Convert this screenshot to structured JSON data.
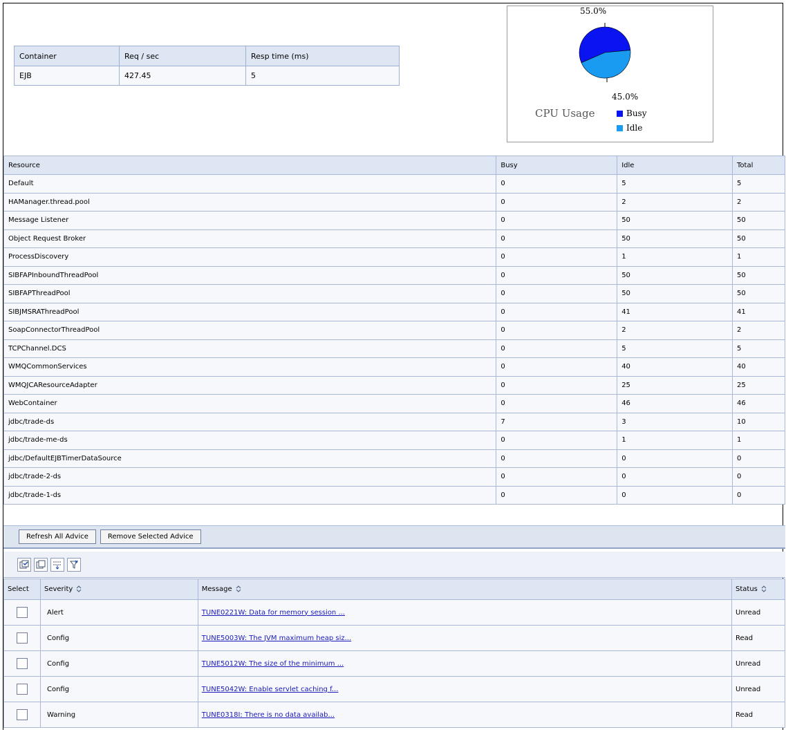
{
  "container_table": {
    "headers": [
      "Container",
      "Req / sec",
      "Resp time (ms)"
    ],
    "rows": [
      [
        "EJB",
        "427.45",
        "5"
      ]
    ]
  },
  "cpu_chart": {
    "chart_data": {
      "type": "pie",
      "title": "CPU Usage",
      "series": [
        {
          "name": "Busy",
          "value": 55.0,
          "color": "#0a14f0"
        },
        {
          "name": "Idle",
          "value": 45.0,
          "color": "#1a9bf2"
        }
      ],
      "labels": [
        "55.0%",
        "45.0%"
      ],
      "legend_position": "bottom-right"
    }
  },
  "resource_table": {
    "headers": [
      "Resource",
      "Busy",
      "Idle",
      "Total"
    ],
    "rows": [
      [
        "Default",
        "0",
        "5",
        "5"
      ],
      [
        "HAManager.thread.pool",
        "0",
        "2",
        "2"
      ],
      [
        "Message Listener",
        "0",
        "50",
        "50"
      ],
      [
        "Object Request Broker",
        "0",
        "50",
        "50"
      ],
      [
        "ProcessDiscovery",
        "0",
        "1",
        "1"
      ],
      [
        "SIBFAPInboundThreadPool",
        "0",
        "50",
        "50"
      ],
      [
        "SIBFAPThreadPool",
        "0",
        "50",
        "50"
      ],
      [
        "SIBJMSRAThreadPool",
        "0",
        "41",
        "41"
      ],
      [
        "SoapConnectorThreadPool",
        "0",
        "2",
        "2"
      ],
      [
        "TCPChannel.DCS",
        "0",
        "5",
        "5"
      ],
      [
        "WMQCommonServices",
        "0",
        "40",
        "40"
      ],
      [
        "WMQJCAResourceAdapter",
        "0",
        "25",
        "25"
      ],
      [
        "WebContainer",
        "0",
        "46",
        "46"
      ],
      [
        "jdbc/trade-ds",
        "7",
        "3",
        "10"
      ],
      [
        "jdbc/trade-me-ds",
        "0",
        "1",
        "1"
      ],
      [
        "jdbc/DefaultEJBTimerDataSource",
        "0",
        "0",
        "0"
      ],
      [
        "jdbc/trade-2-ds",
        "0",
        "0",
        "0"
      ],
      [
        "jdbc/trade-1-ds",
        "0",
        "0",
        "0"
      ]
    ]
  },
  "advice": {
    "buttons": {
      "refresh": "Refresh All Advice",
      "remove": "Remove Selected Advice"
    },
    "toolbar_icons": [
      "select-all-icon",
      "deselect-all-icon",
      "show-filter-icon",
      "clear-filter-icon"
    ],
    "headers": {
      "select": "Select",
      "severity": "Severity",
      "message": "Message",
      "status": "Status"
    },
    "rows": [
      {
        "severity": "Alert",
        "message": "TUNE0221W: Data for memory session ...",
        "status": "Unread"
      },
      {
        "severity": "Config",
        "message": "TUNE5003W: The JVM maximum heap siz...",
        "status": "Read"
      },
      {
        "severity": "Config",
        "message": "TUNE5012W: The size of the minimum ...",
        "status": "Unread"
      },
      {
        "severity": "Config",
        "message": "TUNE5042W: Enable servlet caching f...",
        "status": "Unread"
      },
      {
        "severity": "Warning",
        "message": "TUNE0318I: There is no data availab...",
        "status": "Read"
      }
    ]
  }
}
